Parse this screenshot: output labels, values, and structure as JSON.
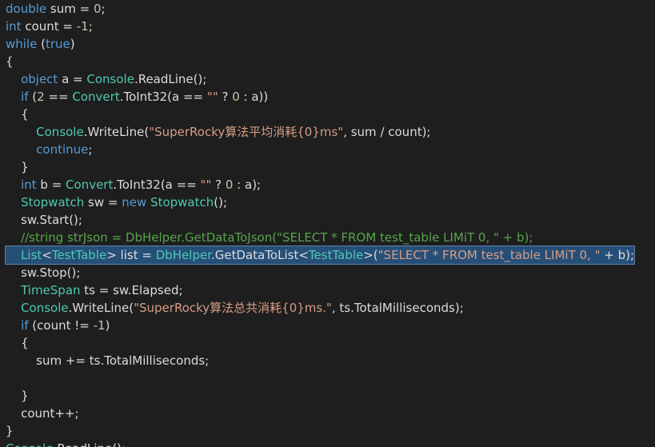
{
  "editor": {
    "colors": {
      "background": "#1e1e1e",
      "plain": "#dcdcdc",
      "keyword": "#569cd6",
      "type": "#4ec9b0",
      "string": "#d69d85",
      "number": "#b5cea8",
      "comment": "#57a64a",
      "selection": "#264f78"
    },
    "selected_line": 14,
    "lines": [
      [
        [
          "kw",
          "double"
        ],
        [
          "p",
          " sum = "
        ],
        [
          "num",
          "0"
        ],
        [
          "p",
          ";"
        ]
      ],
      [
        [
          "kw",
          "int"
        ],
        [
          "p",
          " count = "
        ],
        [
          "num",
          "-1"
        ],
        [
          "p",
          ";"
        ]
      ],
      [
        [
          "kw",
          "while"
        ],
        [
          "p",
          " ("
        ],
        [
          "kw",
          "true"
        ],
        [
          "p",
          ")"
        ]
      ],
      [
        [
          "p",
          "{"
        ]
      ],
      [
        [
          "p",
          "    "
        ],
        [
          "kw",
          "object"
        ],
        [
          "p",
          " a = "
        ],
        [
          "type",
          "Console"
        ],
        [
          "p",
          ".ReadLine();"
        ]
      ],
      [
        [
          "p",
          "    "
        ],
        [
          "kw",
          "if"
        ],
        [
          "p",
          " ("
        ],
        [
          "num",
          "2"
        ],
        [
          "p",
          " == "
        ],
        [
          "type",
          "Convert"
        ],
        [
          "p",
          ".ToInt32(a == "
        ],
        [
          "str",
          "\"\""
        ],
        [
          "p",
          " ? "
        ],
        [
          "num",
          "0"
        ],
        [
          "p",
          " : a))"
        ]
      ],
      [
        [
          "p",
          "    {"
        ]
      ],
      [
        [
          "p",
          "        "
        ],
        [
          "type",
          "Console"
        ],
        [
          "p",
          ".WriteLine("
        ],
        [
          "str",
          "\"SuperRocky算法平均消耗{0}ms\""
        ],
        [
          "p",
          ", sum / count);"
        ]
      ],
      [
        [
          "p",
          "        "
        ],
        [
          "kw",
          "continue"
        ],
        [
          "p",
          ";"
        ]
      ],
      [
        [
          "p",
          "    }"
        ]
      ],
      [
        [
          "p",
          "    "
        ],
        [
          "kw",
          "int"
        ],
        [
          "p",
          " b = "
        ],
        [
          "type",
          "Convert"
        ],
        [
          "p",
          ".ToInt32(a == "
        ],
        [
          "str",
          "\"\""
        ],
        [
          "p",
          " ? "
        ],
        [
          "num",
          "0"
        ],
        [
          "p",
          " : a);"
        ]
      ],
      [
        [
          "p",
          "    "
        ],
        [
          "type",
          "Stopwatch"
        ],
        [
          "p",
          " sw = "
        ],
        [
          "kw",
          "new"
        ],
        [
          "p",
          " "
        ],
        [
          "type",
          "Stopwatch"
        ],
        [
          "p",
          "();"
        ]
      ],
      [
        [
          "p",
          "    sw.Start();"
        ]
      ],
      [
        [
          "p",
          "    "
        ],
        [
          "com",
          "//string strJson = DbHelper.GetDataToJson(\"SELECT * FROM test_table LIMiT 0, \" + b);"
        ]
      ],
      [
        [
          "p",
          "    "
        ],
        [
          "type",
          "List"
        ],
        [
          "p",
          "<"
        ],
        [
          "type",
          "TestTable"
        ],
        [
          "p",
          "> list = "
        ],
        [
          "type",
          "DbHelper"
        ],
        [
          "p",
          ".GetDataToList<"
        ],
        [
          "type",
          "TestTable"
        ],
        [
          "p",
          ">("
        ],
        [
          "str",
          "\"SELECT * FROM test_table LIMiT 0, \""
        ],
        [
          "p",
          " + b);"
        ]
      ],
      [
        [
          "p",
          "    sw.Stop();"
        ]
      ],
      [
        [
          "p",
          "    "
        ],
        [
          "type",
          "TimeSpan"
        ],
        [
          "p",
          " ts = sw.Elapsed;"
        ]
      ],
      [
        [
          "p",
          "    "
        ],
        [
          "type",
          "Console"
        ],
        [
          "p",
          ".WriteLine("
        ],
        [
          "str",
          "\"SuperRocky算法总共消耗{0}ms.\""
        ],
        [
          "p",
          ", ts.TotalMilliseconds);"
        ]
      ],
      [
        [
          "p",
          "    "
        ],
        [
          "kw",
          "if"
        ],
        [
          "p",
          " (count != "
        ],
        [
          "num",
          "-1"
        ],
        [
          "p",
          ")"
        ]
      ],
      [
        [
          "p",
          "    {"
        ]
      ],
      [
        [
          "p",
          "        sum += ts.TotalMilliseconds;"
        ]
      ],
      [
        [
          "p",
          ""
        ]
      ],
      [
        [
          "p",
          "    }"
        ]
      ],
      [
        [
          "p",
          "    count++;"
        ]
      ],
      [
        [
          "p",
          "}"
        ]
      ],
      [
        [
          "type",
          "Console"
        ],
        [
          "p",
          ".ReadLine();"
        ]
      ]
    ]
  }
}
